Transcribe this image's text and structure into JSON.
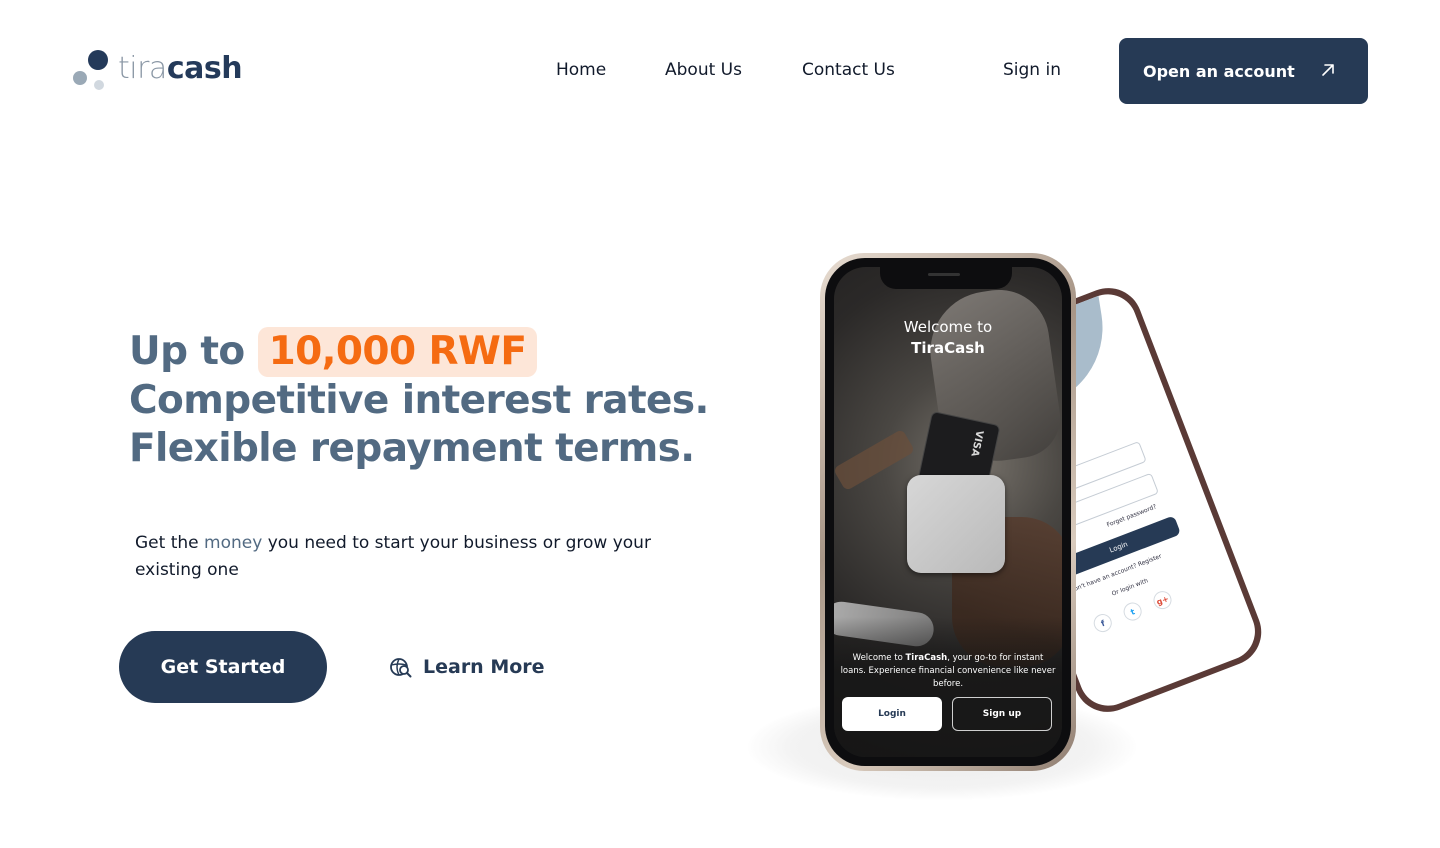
{
  "brand": {
    "logo_light": "tira",
    "logo_bold": "cash"
  },
  "nav": {
    "home": "Home",
    "about": "About Us",
    "contact": "Contact Us",
    "signin": "Sign in",
    "cta": "Open an account"
  },
  "hero": {
    "headline_pre": "Up to",
    "headline_highlight": "10,000 RWF",
    "headline_post": "Competitive interest rates. Flexible repayment terms.",
    "sub_pre": "Get the",
    "sub_money": "money",
    "sub_post": "you need to start your business or grow your existing one",
    "get_started": "Get Started",
    "learn_more": "Learn More"
  },
  "phone_front": {
    "welcome_line1": "Welcome to",
    "welcome_line2": "TiraCash",
    "desc_pre": "Welcome to",
    "desc_brand": "TiraCash",
    "desc_post": ", your go-to for instant loans. Experience financial convenience like never before.",
    "login": "Login",
    "signup": "Sign up",
    "card_text": "VISA"
  },
  "phone_back": {
    "forgot": "Forget password?",
    "login": "Login",
    "no_account": "Don't have an account? Register",
    "or_login": "Or login with",
    "social": [
      "f",
      "t",
      "g+"
    ]
  },
  "colors": {
    "navy": "#263a55",
    "slate": "#526a82",
    "orange": "#f56b12",
    "highlight_bg": "#fde6d8"
  }
}
